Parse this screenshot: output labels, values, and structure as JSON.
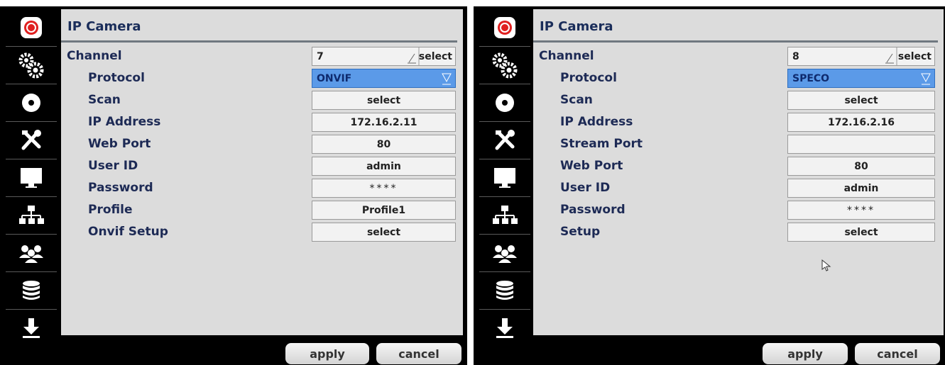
{
  "panels": [
    {
      "title": "IP Camera",
      "channel_label": "Channel",
      "channel_value": "7",
      "channel_select": "select",
      "rows": [
        {
          "label": "Protocol",
          "value": "ONVIF"
        },
        {
          "label": "Scan",
          "value": "select"
        },
        {
          "label": "IP Address",
          "value": "172.16.2.11"
        },
        {
          "label": "Web Port",
          "value": "80"
        },
        {
          "label": "User ID",
          "value": "admin"
        },
        {
          "label": "Password",
          "value": "****"
        },
        {
          "label": "Profile",
          "value": "Profile1"
        },
        {
          "label": "Onvif Setup",
          "value": "select"
        }
      ],
      "apply": "apply",
      "cancel": "cancel"
    },
    {
      "title": "IP Camera",
      "channel_label": "Channel",
      "channel_value": "8",
      "channel_select": "select",
      "rows": [
        {
          "label": "Protocol",
          "value": "SPECO"
        },
        {
          "label": "Scan",
          "value": "select"
        },
        {
          "label": "IP Address",
          "value": "172.16.2.16"
        },
        {
          "label": "Stream Port",
          "value": ""
        },
        {
          "label": "Web Port",
          "value": "80"
        },
        {
          "label": "User ID",
          "value": "admin"
        },
        {
          "label": "Password",
          "value": "****"
        },
        {
          "label": "Setup",
          "value": "select"
        }
      ],
      "apply": "apply",
      "cancel": "cancel"
    }
  ],
  "sidebar_icons": [
    "record-icon",
    "gears-icon",
    "disc-icon",
    "tools-icon",
    "monitor-icon",
    "network-icon",
    "users-icon",
    "database-icon",
    "download-icon"
  ],
  "colors": {
    "accent_record": "#e02020",
    "dropdown_selected": "#5b9ae8",
    "title": "#1a2d5a"
  }
}
